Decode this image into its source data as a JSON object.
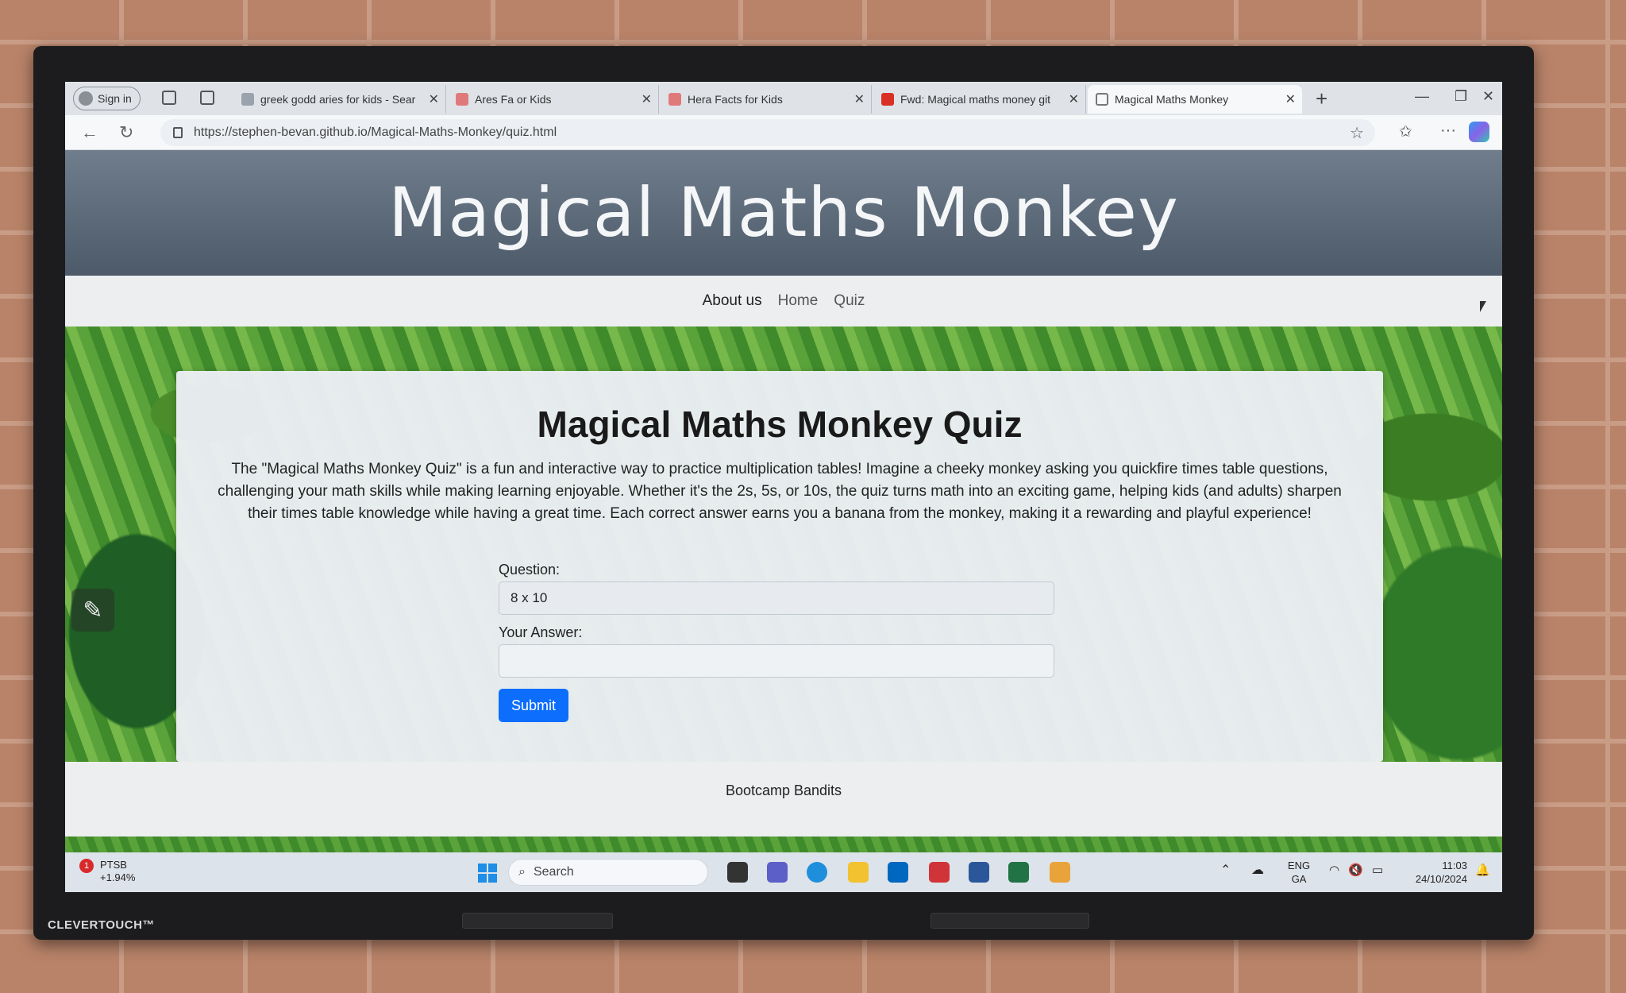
{
  "browser": {
    "sign_in": "Sign in",
    "tabs": [
      {
        "label": "greek godd aries for kids - Sear",
        "color": "#9aa3ad"
      },
      {
        "label": "Ares Fa   or Kids",
        "color": "#e07a7a"
      },
      {
        "label": "Hera Facts for Kids",
        "color": "#e07a7a"
      },
      {
        "label": "Fwd: Magical maths money git",
        "color": "#d93025"
      },
      {
        "label": "Magical Maths Monkey",
        "color": "#777777"
      }
    ],
    "url": "https://stephen-bevan.github.io/Magical-Maths-Monkey/quiz.html"
  },
  "site": {
    "title": "Magical Maths Monkey",
    "nav": [
      "About us",
      "Home",
      "Quiz"
    ]
  },
  "quiz": {
    "heading": "Magical Maths Monkey Quiz",
    "description": "The \"Magical Maths Monkey Quiz\" is a fun and interactive way to practice multiplication tables! Imagine a cheeky monkey asking you quickfire times table questions, challenging your math skills while making learning enjoyable. Whether it's the 2s, 5s, or 10s, the quiz turns math into an exciting game, helping kids (and adults) sharpen their times table knowledge while having a great time. Each correct answer earns you a banana from the monkey, making it a rewarding and playful experience!",
    "question_label": "Question:",
    "question_value": "8 x 10",
    "answer_label": "Your Answer:",
    "answer_value": "",
    "submit_label": "Submit"
  },
  "footer": {
    "text": "Bootcamp Bandits"
  },
  "taskbar": {
    "stock_name": "PTSB",
    "stock_change": "+1.94%",
    "stock_badge": "1",
    "search_placeholder": "Search",
    "lang_top": "ENG",
    "lang_bottom": "GA",
    "time": "11:03",
    "date": "24/10/2024"
  },
  "monitor": {
    "brand": "CLEVERTOUCH™"
  }
}
